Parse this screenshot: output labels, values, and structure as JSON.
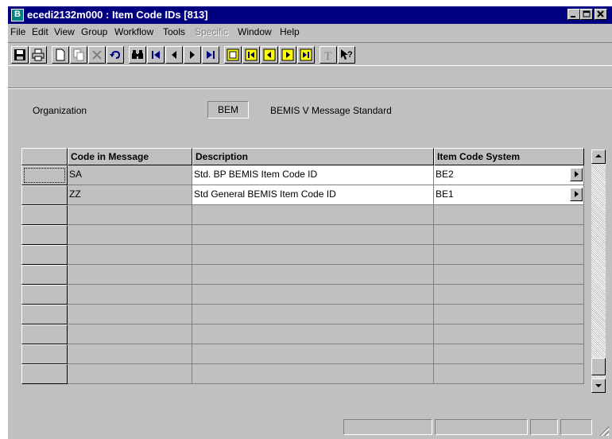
{
  "window": {
    "title": "ecedi2132m000 : Item Code IDs [813]",
    "controls": [
      "minimize",
      "maximize",
      "close"
    ]
  },
  "menubar": {
    "items": [
      {
        "label": "File"
      },
      {
        "label": "Edit"
      },
      {
        "label": "View"
      },
      {
        "label": "Group"
      },
      {
        "label": "Workflow"
      },
      {
        "label": "Tools"
      },
      {
        "label": "Specific",
        "disabled": true
      },
      {
        "label": "Window"
      },
      {
        "label": "Help"
      }
    ]
  },
  "toolbar": {
    "buttons": [
      "save-icon",
      "print-icon",
      "new-icon",
      "copy-icon",
      "delete-icon",
      "undo-icon",
      "find-icon",
      "first-record-icon",
      "previous-record-icon",
      "next-record-icon",
      "last-record-icon",
      "group-icon",
      "group-first-icon",
      "group-previous-icon",
      "group-next-icon",
      "group-last-icon",
      "text-icon",
      "help-pointer-icon"
    ]
  },
  "organization": {
    "label": "Organization",
    "code": "BEM",
    "description": "BEMIS V Message Standard"
  },
  "grid": {
    "columns": [
      "Code in Message",
      "Description",
      "Item Code System"
    ],
    "rows": [
      {
        "code": "SA",
        "description": "Std. BP BEMIS Item Code ID",
        "system": "BE2"
      },
      {
        "code": "ZZ",
        "description": "Std General BEMIS Item Code ID",
        "system": "BE1"
      }
    ],
    "empty_rows": 9
  },
  "colors": {
    "titlebar": "#000080",
    "face": "#c0c0c0"
  }
}
